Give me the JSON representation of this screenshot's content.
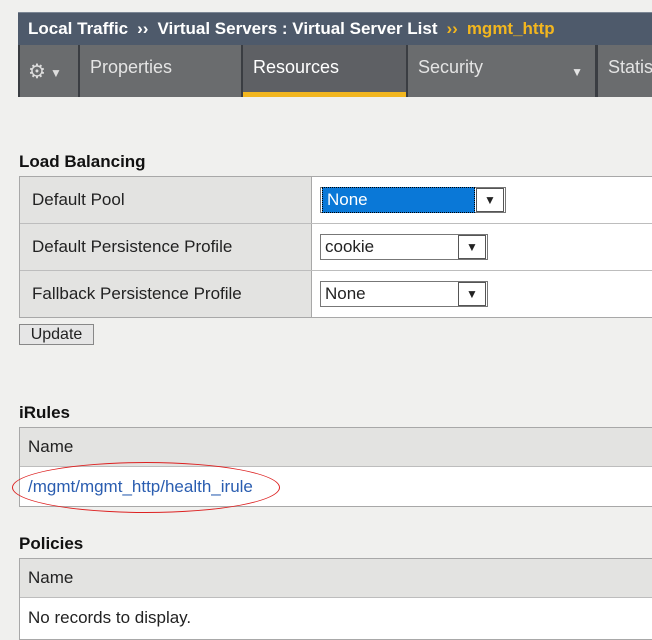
{
  "breadcrumb": {
    "item1": "Local Traffic",
    "sep": "››",
    "item2": "Virtual Servers : Virtual Server List",
    "current": "mgmt_http"
  },
  "tabs": [
    {
      "label": "Properties"
    },
    {
      "label": "Resources"
    },
    {
      "label": "Security"
    },
    {
      "label": "Statis"
    }
  ],
  "load_balancing": {
    "title": "Load Balancing",
    "rows": [
      {
        "label": "Default Pool",
        "value": "None"
      },
      {
        "label": "Default Persistence Profile",
        "value": "cookie"
      },
      {
        "label": "Fallback Persistence Profile",
        "value": "None"
      }
    ],
    "update_label": "Update"
  },
  "irules": {
    "title": "iRules",
    "header": "Name",
    "items": [
      "/mgmt/mgmt_http/health_irule"
    ]
  },
  "policies": {
    "title": "Policies",
    "header": "Name",
    "empty": "No records to display."
  },
  "colors": {
    "accent": "#f2b61f",
    "link": "#2a5db0",
    "annotation": "#dd2222"
  }
}
